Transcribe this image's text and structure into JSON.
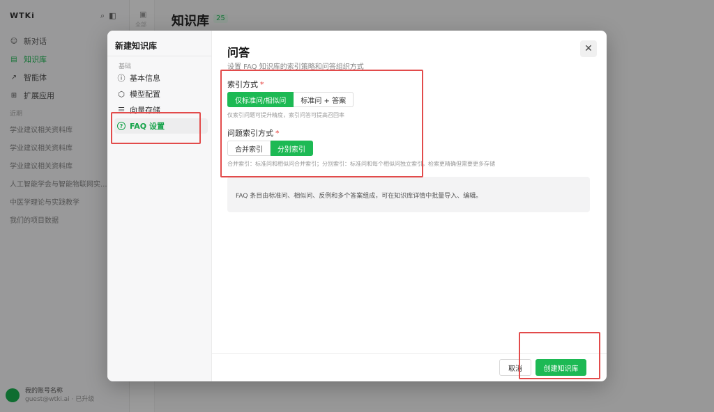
{
  "background": {
    "logo": "WTKi",
    "nav": [
      {
        "icon": "chat-icon",
        "glyph": "☺",
        "label": "新对话",
        "active": false
      },
      {
        "icon": "book-icon",
        "glyph": "▤",
        "label": "知识库",
        "active": true
      },
      {
        "icon": "tool-icon",
        "glyph": "↗",
        "label": "智能体",
        "active": false
      },
      {
        "icon": "grid-icon",
        "glyph": "⊞",
        "label": "扩展应用",
        "active": false
      }
    ],
    "section_label": "近期",
    "history": [
      "学业建议相关资料库",
      "学业建议相关资料库",
      "学业建议相关资料库",
      "人工智能学会与智能物联网实...",
      "中医学理论与实践教学",
      "我们的项目数据"
    ],
    "user": {
      "name": "我的账号名称",
      "sub": "guest@wtki.ai · 已升级"
    },
    "rail_label": "全部",
    "main_title": "知识库",
    "main_badge": "25"
  },
  "modal": {
    "title": "新建知识库",
    "section_label": "基础",
    "nav": [
      {
        "icon": "info-icon",
        "glyph": "ⓘ",
        "label": "基本信息",
        "active": false
      },
      {
        "icon": "cube-icon",
        "glyph": "⬡",
        "label": "模型配置",
        "active": false
      },
      {
        "icon": "database-icon",
        "glyph": "☰",
        "label": "向量存储",
        "active": false
      },
      {
        "icon": "help-circle-icon",
        "glyph": "?",
        "label": "FAQ 设置",
        "active": true
      }
    ],
    "content_title": "问答",
    "content_subtitle": "设置 FAQ 知识库的索引策略和问答组织方式",
    "close_glyph": "✕",
    "index_mode": {
      "label": "索引方式",
      "required": "*",
      "options": [
        "仅标准问/相似问",
        "标准问 + 答案"
      ],
      "selected": 0,
      "hint": "仅索引问题可提升精度，索引问答可提高召回率"
    },
    "question_index_mode": {
      "label": "问题索引方式",
      "required": "*",
      "options": [
        "合并索引",
        "分别索引"
      ],
      "selected": 1,
      "hint": "合并索引：标准问和相似问合并索引；分别索引：标准问和每个相似问独立索引，检索更精确但需要更多存储"
    },
    "info_text": "FAQ 条目由标准问、相似问、反例和多个答案组成，可在知识库详情中批量导入、编辑。",
    "cancel_label": "取消",
    "create_label": "创建知识库"
  }
}
